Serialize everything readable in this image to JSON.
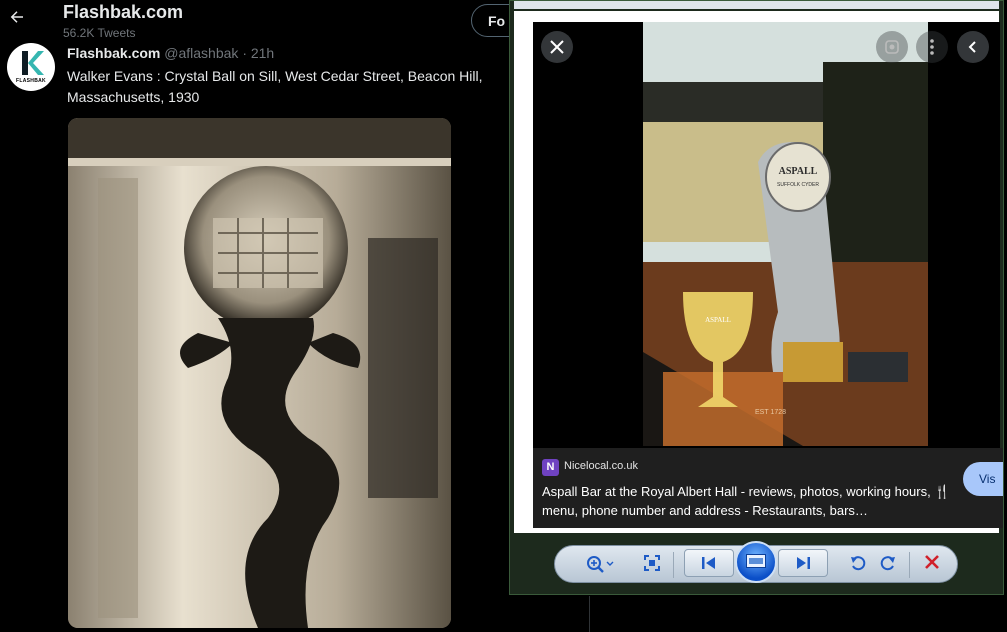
{
  "twitter": {
    "account_name": "Flashbak.com",
    "tweet_count": "56.2K Tweets",
    "follow_label": "Fo",
    "tweet": {
      "name": "Flashbak.com",
      "handle": "@aflashbak",
      "time": "· 21h",
      "text": "Walker Evans : Crystal Ball on Sill, West Cedar Street, Beacon Hill, Massachusetts, 1930"
    },
    "avatar_text": "FLASHBAK",
    "icons": {
      "back": "arrow-left-icon"
    }
  },
  "viewer": {
    "card": {
      "source_icon_letter": "N",
      "source": "Nicelocal.co.uk",
      "title": "Aspall Bar at the Royal Albert Hall - reviews, photos, working hours, 🍴 menu, phone number and address - Restaurants, bars…",
      "visit_label": "Vis"
    },
    "photo_text": {
      "tap_brand": "ASPALL",
      "tap_sub": "SUFFOLK CYDER",
      "glass_brand": "ASPALL",
      "mat_year": "EST 1728"
    },
    "icons": {
      "close": "close-icon",
      "lens": "lens-icon",
      "more": "more-vert-icon",
      "collapse": "chevron-left-icon"
    },
    "toolbar": {
      "zoom": "zoom-icon",
      "fit": "fit-window-icon",
      "previous": "previous-icon",
      "slideshow": "slideshow-icon",
      "next": "next-icon",
      "rotate_ccw": "rotate-ccw-icon",
      "rotate_cw": "rotate-cw-icon",
      "delete": "delete-icon"
    }
  },
  "colors": {
    "twitter_bg": "#000000",
    "twitter_text": "#e7e9ea",
    "twitter_muted": "#71767b",
    "viewer_frame": "#1d2a1d",
    "visit_button": "#a8c7fa",
    "toolbar_blue": "#1e5bc6",
    "delete_red": "#d0202a"
  }
}
